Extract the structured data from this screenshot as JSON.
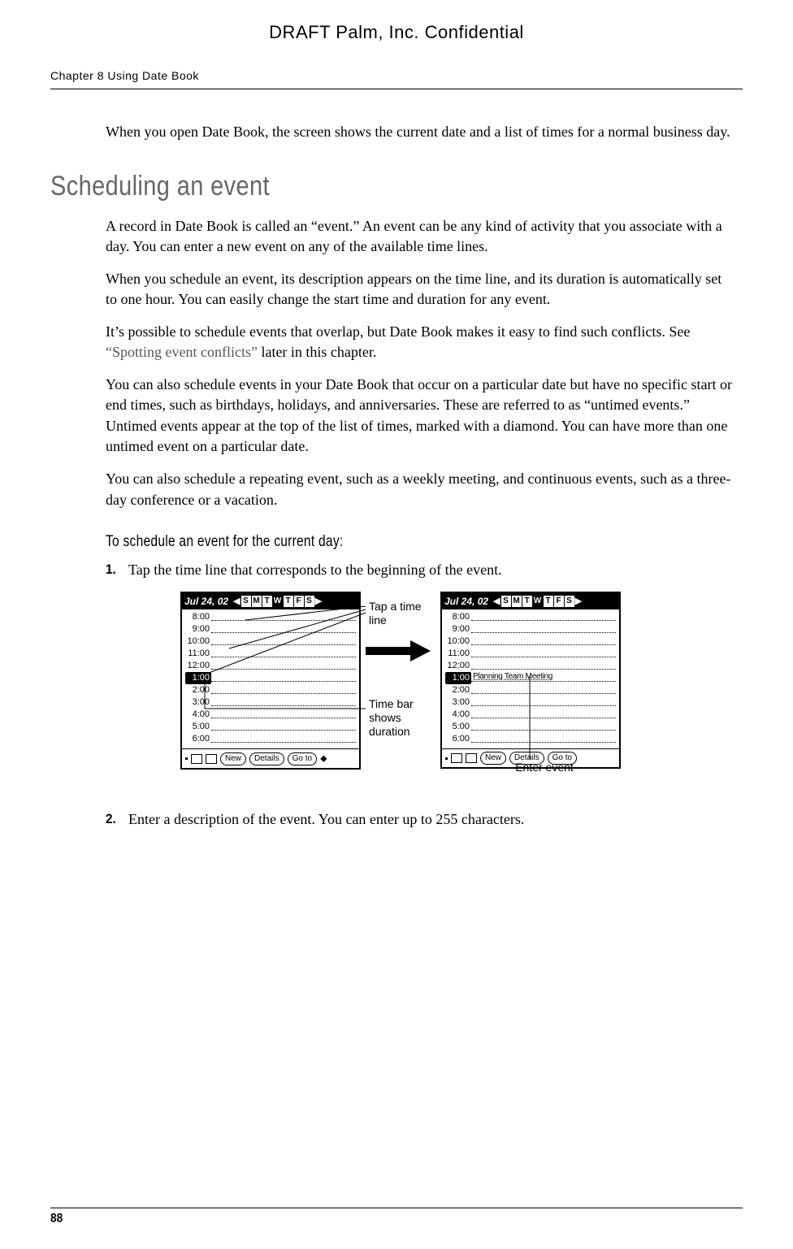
{
  "draft": "DRAFT   Palm, Inc. Confidential",
  "chapter": "Chapter 8   Using Date Book",
  "pageNumber": "88",
  "intro": "When you open Date Book, the screen shows the current date and a list of times for a normal business day.",
  "section1": {
    "title": "Scheduling an event",
    "p1": "A record in Date Book is called an “event.” An event can be any kind of activity that you associate with a day. You can enter a new event on any of the available time lines.",
    "p2": "When you schedule an event, its description appears on the time line, and its duration is automatically set to one hour. You can easily change the start time and duration for any event.",
    "p3a": "It’s possible to schedule events that overlap, but Date Book makes it easy to find such conflicts. See ",
    "p3link": "“Spotting event conflicts”",
    "p3b": " later in this chapter.",
    "p4": "You can also schedule events in your Date Book that occur on a particular date but have no specific start or end times, such as birthdays, holidays, and anniversaries. These are referred to as “untimed events.” Untimed events appear at the top of the list of times, marked with a diamond. You can have more than one untimed event on a particular date.",
    "p5": "You can also schedule a repeating event, such as a weekly meeting, and continuous events, such as a three-day conference or a vacation."
  },
  "subhead": "To schedule an event for the current day:",
  "steps": {
    "1": "Tap the time line that corresponds to the beginning of the event.",
    "2": "Enter a description of the event. You can enter up to 255 characters."
  },
  "figure": {
    "date": "Jul 24, 02",
    "days": [
      "S",
      "M",
      "T",
      "W",
      "T",
      "F",
      "S"
    ],
    "selectedDay": 3,
    "times": [
      "8:00",
      "9:00",
      "10:00",
      "11:00",
      "12:00",
      "1:00",
      "2:00",
      "3:00",
      "4:00",
      "5:00",
      "6:00"
    ],
    "selectedTime": "1:00",
    "eventText": "Planning Team Meeting",
    "buttons": {
      "new": "New",
      "details": "Details",
      "goto": "Go to"
    },
    "annot1": "Tap a time line",
    "annot2": "Time bar shows duration",
    "annot3": "Enter event"
  }
}
